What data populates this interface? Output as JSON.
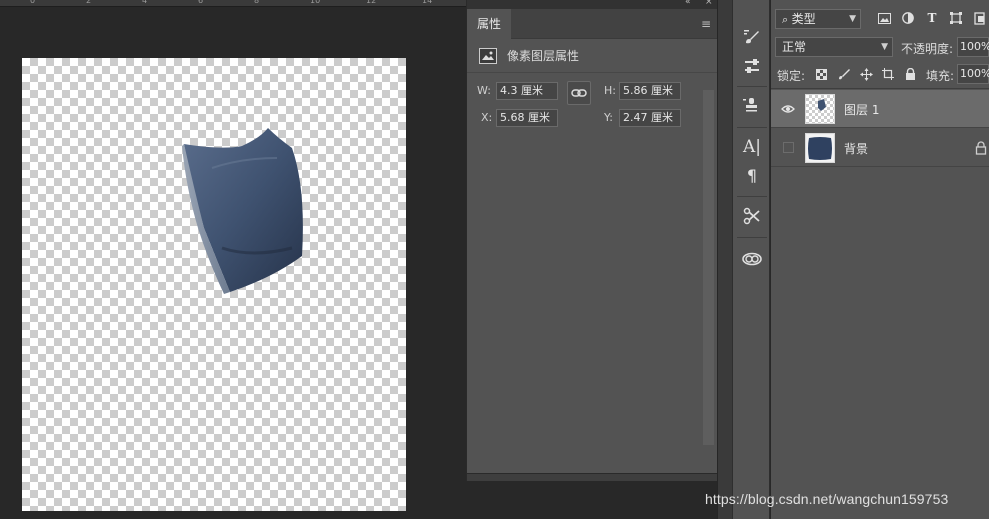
{
  "ruler": {
    "labels": [
      "0",
      "2",
      "4",
      "6",
      "8",
      "10",
      "12",
      "14"
    ]
  },
  "properties_panel": {
    "tab_label": "属性",
    "header_title": "像素图层属性",
    "w_label": "W:",
    "w_value": "4.3 厘米",
    "h_label": "H:",
    "h_value": "5.86 厘米",
    "x_label": "X:",
    "x_value": "5.68 厘米",
    "y_label": "Y:",
    "y_value": "2.47 厘米",
    "collapse_icon": "double-chevron-left-icon",
    "close_icon": "close-icon",
    "menu_icon": "hamburger-menu-icon"
  },
  "layers_panel": {
    "filter_kind": "类型",
    "blend_mode": "正常",
    "opacity_label": "不透明度:",
    "opacity_value": "100%",
    "lock_label": "锁定:",
    "fill_label": "填充:",
    "fill_value": "100%",
    "layers": [
      {
        "name": "图层 1",
        "visible": true,
        "selected": true,
        "locked": false
      },
      {
        "name": "背景",
        "visible": false,
        "selected": false,
        "locked": true
      }
    ]
  },
  "colors": {
    "canvas_bg": "#282828",
    "panel_bg": "#535353",
    "selected_layer": "#6b6b6b",
    "pillow": "#3f5270"
  },
  "watermark": "https://blog.csdn.net/wangchun159753"
}
